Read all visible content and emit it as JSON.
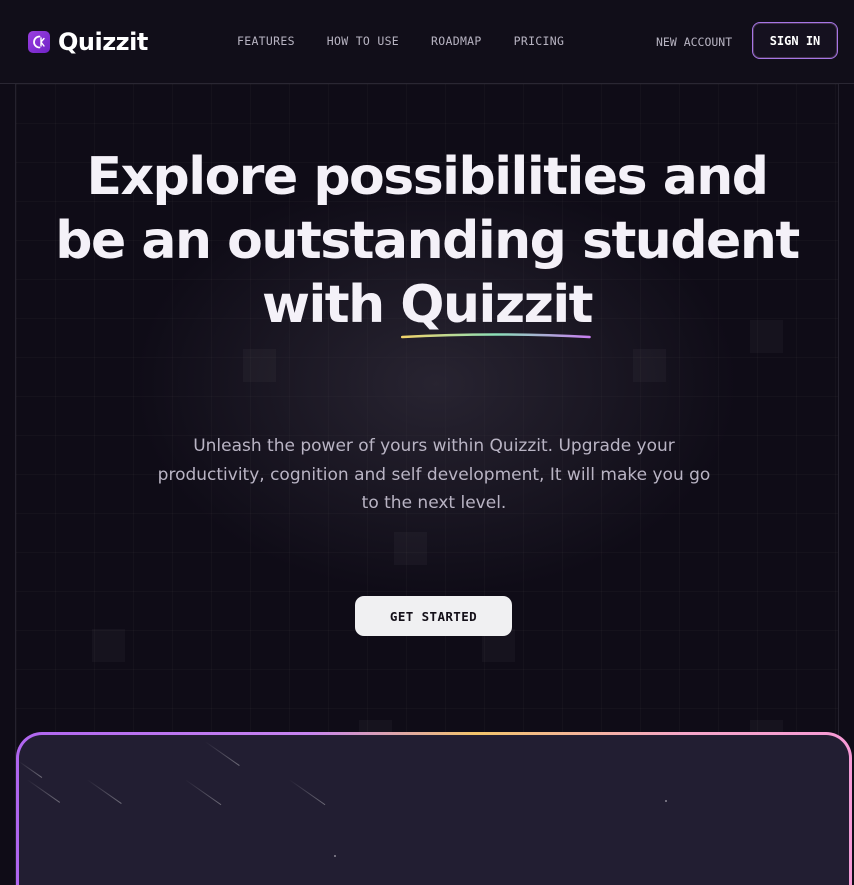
{
  "brand": {
    "name": "Quizzit",
    "logo_color": "#8a2fd6"
  },
  "nav": {
    "links": [
      "FEATURES",
      "HOW TO USE",
      "ROADMAP",
      "PRICING"
    ],
    "new_account": "NEW ACCOUNT",
    "sign_in": "SIGN IN"
  },
  "hero": {
    "headline_line1": "Explore possibilities and",
    "headline_line2": "be an outstanding student",
    "headline_line3_prefix": "with ",
    "headline_brand": "Quizzit",
    "subtitle": "Unleash the power of yours within Quizzit. Upgrade your productivity, cognition and self development, It will make you go to the next level.",
    "cta": "GET STARTED"
  },
  "colors": {
    "background": "#0f0c17",
    "accent_purple": "#a676e6",
    "accent_gold": "#f2c46b",
    "accent_pink": "#f79ad6",
    "panel": "#221e32"
  }
}
